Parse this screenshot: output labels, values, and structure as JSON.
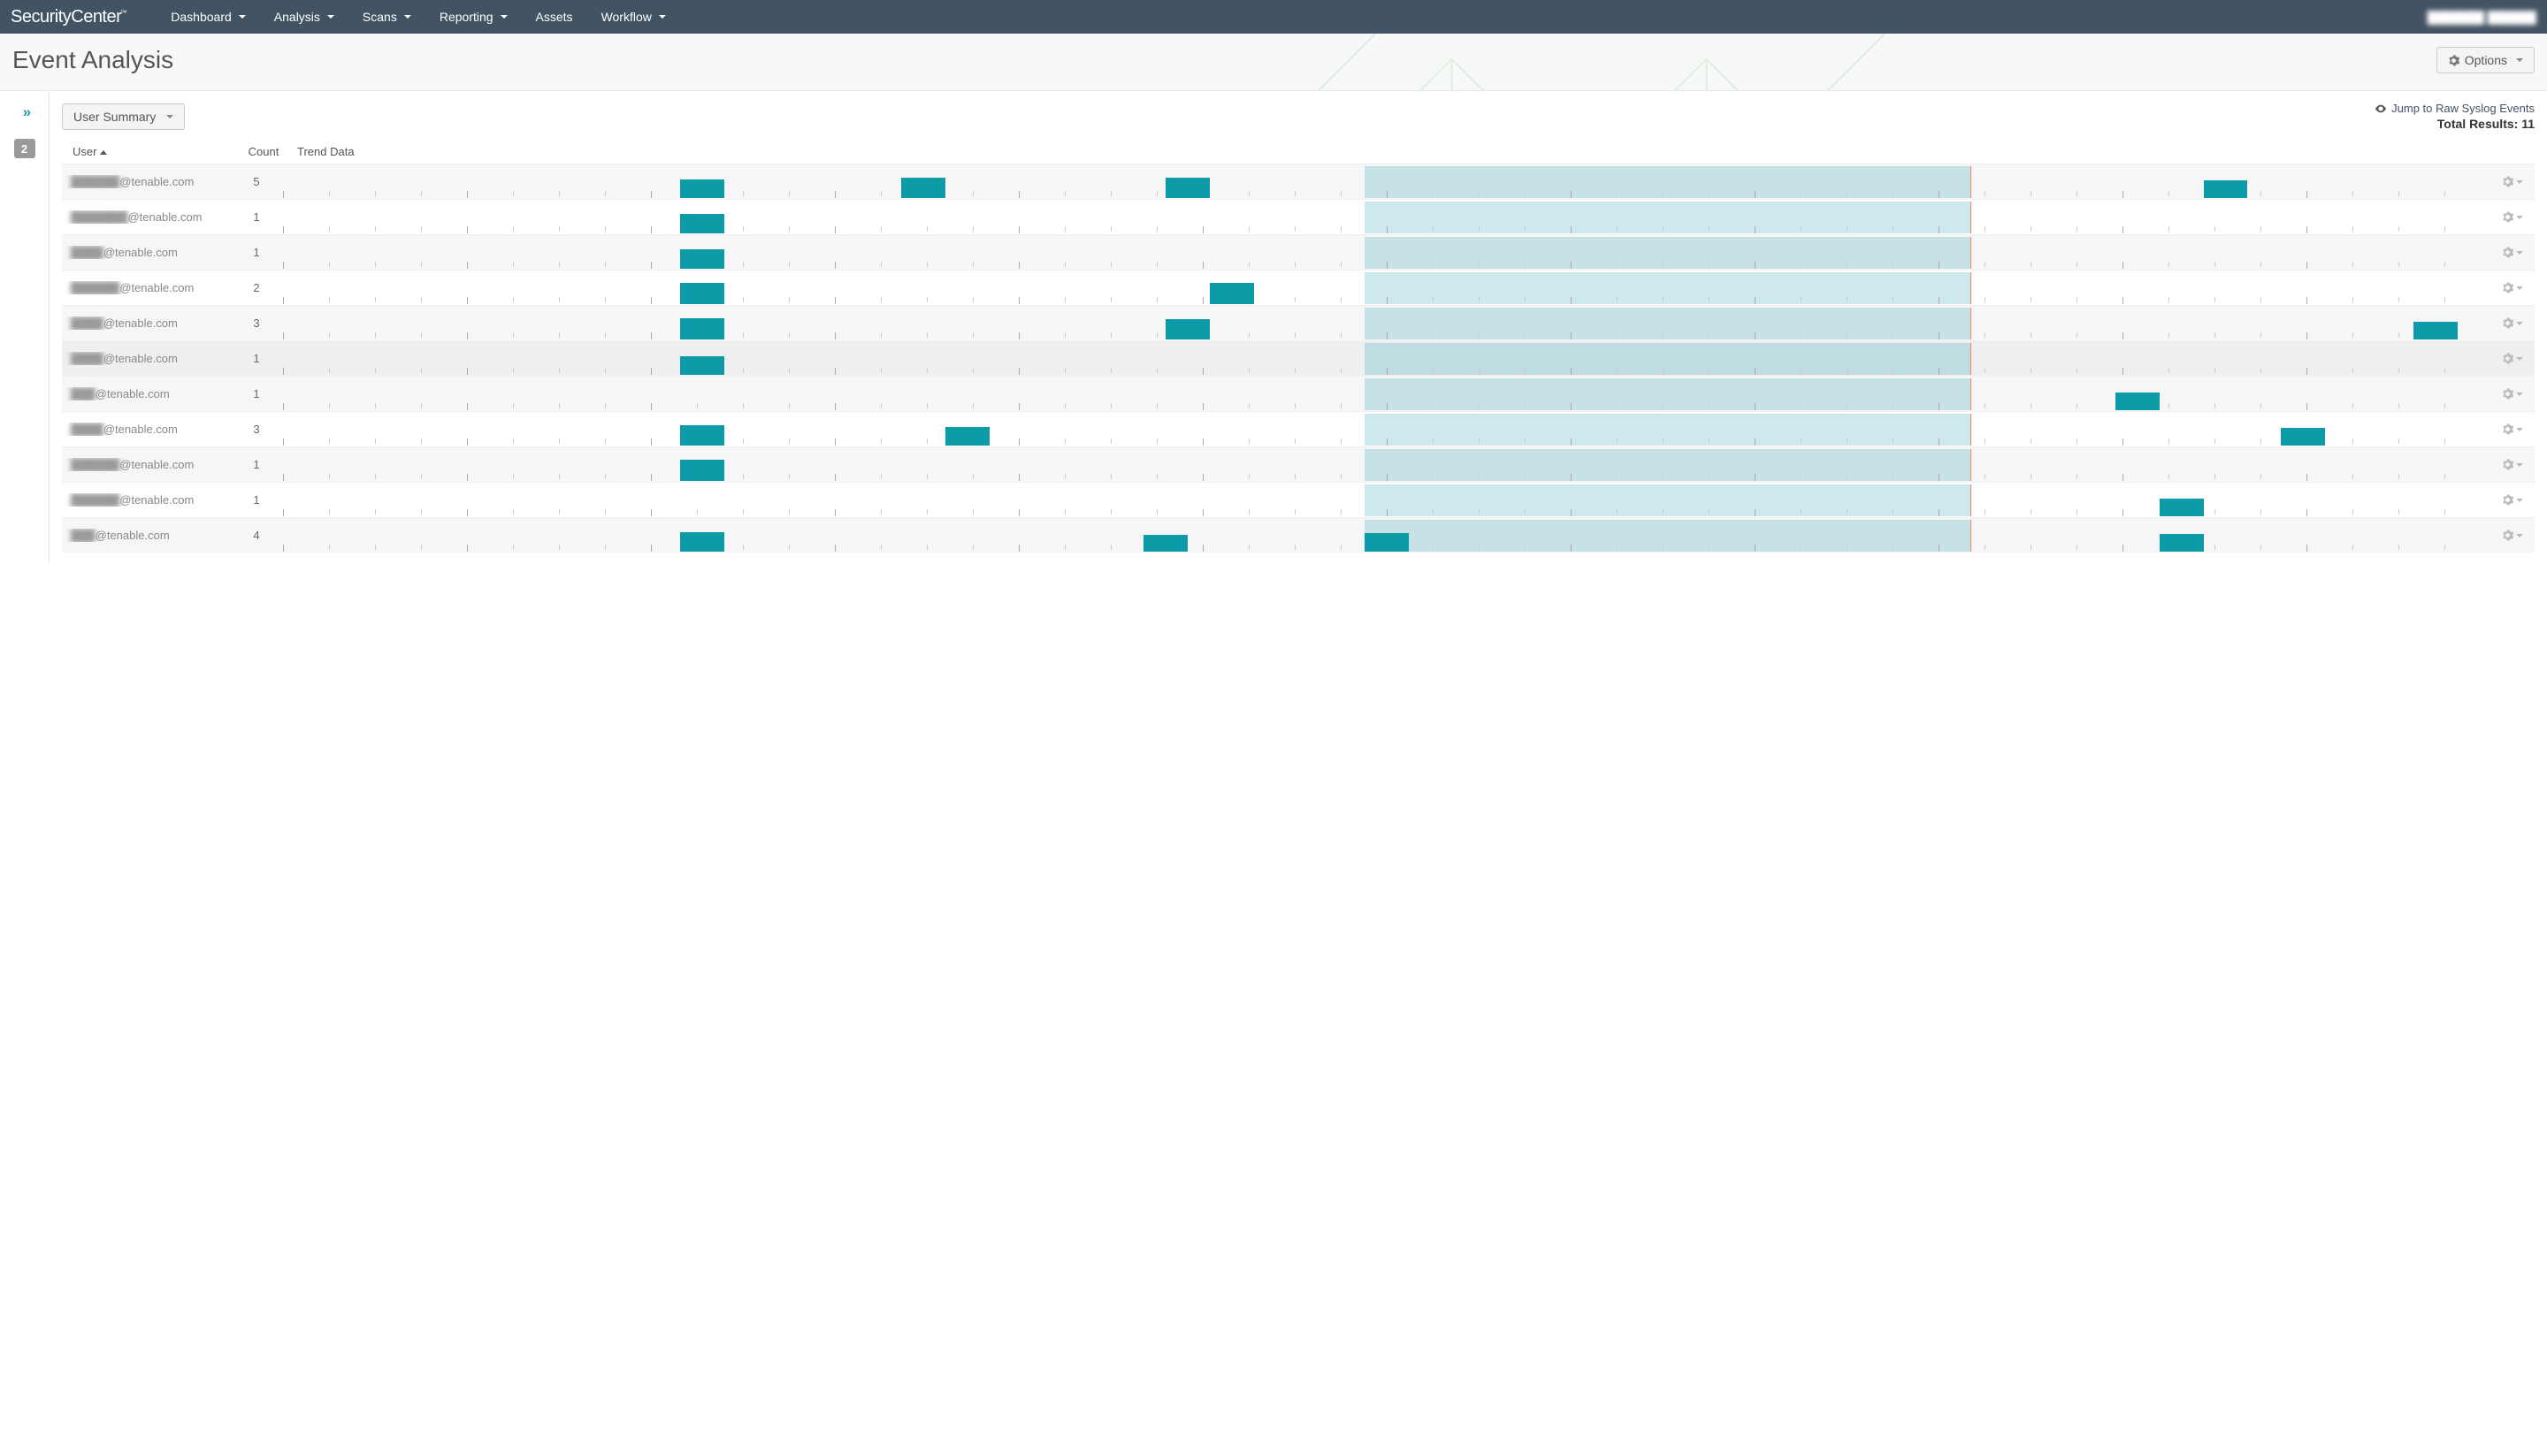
{
  "brand": "SecurityCenter",
  "nav": {
    "items": [
      {
        "label": "Dashboard",
        "dropdown": true
      },
      {
        "label": "Analysis",
        "dropdown": true
      },
      {
        "label": "Scans",
        "dropdown": true
      },
      {
        "label": "Reporting",
        "dropdown": true
      },
      {
        "label": "Assets",
        "dropdown": false
      },
      {
        "label": "Workflow",
        "dropdown": true
      }
    ],
    "user_display": "███████ ██████"
  },
  "page": {
    "title": "Event Analysis",
    "options_label": "Options"
  },
  "sidebar": {
    "filter_count": "2"
  },
  "toolbar": {
    "view_label": "User Summary",
    "jump_link": "Jump to Raw Syslog Events",
    "total_label": "Total Results: 11"
  },
  "columns": {
    "user": "User",
    "count": "Count",
    "trend": "Trend Data"
  },
  "colors": {
    "bar": "#0d9ba8",
    "band": "rgba(28,155,168,0.22)",
    "band_border": "#f08a5d"
  },
  "rows": [
    {
      "user_prefix": "██████",
      "user_suffix": "@tenable.com",
      "count": "5",
      "bars": [
        18,
        28,
        40
      ],
      "bar2_at": 87
    },
    {
      "user_prefix": "███████",
      "user_suffix": "@tenable.com",
      "count": "1",
      "bars": [
        18
      ]
    },
    {
      "user_prefix": "████",
      "user_suffix": "@tenable.com",
      "count": "1",
      "bars": [
        18
      ]
    },
    {
      "user_prefix": "██████",
      "user_suffix": "@tenable.com",
      "count": "2",
      "bars": [
        18,
        42
      ]
    },
    {
      "user_prefix": "████",
      "user_suffix": "@tenable.com",
      "count": "3",
      "bars": [
        18,
        40
      ],
      "bar2_at": 96.5
    },
    {
      "user_prefix": "████",
      "user_suffix": "@tenable.com",
      "count": "1",
      "bars": [
        18
      ],
      "hovered": true
    },
    {
      "user_prefix": "███",
      "user_suffix": "@tenable.com",
      "count": "1",
      "bars": [],
      "bar2_at": 83
    },
    {
      "user_prefix": "████",
      "user_suffix": "@tenable.com",
      "count": "3",
      "bars": [
        18,
        30
      ],
      "bar2_at": 90.5
    },
    {
      "user_prefix": "██████",
      "user_suffix": "@tenable.com",
      "count": "1",
      "bars": [
        18
      ]
    },
    {
      "user_prefix": "██████",
      "user_suffix": "@tenable.com",
      "count": "1",
      "bars": [],
      "bar2_at": 85
    },
    {
      "user_prefix": "███",
      "user_suffix": "@tenable.com",
      "count": "4",
      "bars": [
        18,
        39,
        49
      ],
      "bar2_at": 85
    }
  ],
  "chart_data": {
    "type": "bar",
    "note": "Per-row sparkline event timelines. X = relative time 0-100%. Highlighted band ≈ 49%–76.5%. Bars mark event occurrences.",
    "highlight_range_pct": [
      49,
      76.5
    ],
    "series": [
      {
        "name": "row1",
        "x_pct": [
          18,
          28,
          40,
          87
        ]
      },
      {
        "name": "row2",
        "x_pct": [
          18
        ]
      },
      {
        "name": "row3",
        "x_pct": [
          18
        ]
      },
      {
        "name": "row4",
        "x_pct": [
          18,
          42
        ]
      },
      {
        "name": "row5",
        "x_pct": [
          18,
          40,
          96.5
        ]
      },
      {
        "name": "row6",
        "x_pct": [
          18
        ]
      },
      {
        "name": "row7",
        "x_pct": [
          83
        ]
      },
      {
        "name": "row8",
        "x_pct": [
          18,
          30,
          90.5
        ]
      },
      {
        "name": "row9",
        "x_pct": [
          18
        ]
      },
      {
        "name": "row10",
        "x_pct": [
          85
        ]
      },
      {
        "name": "row11",
        "x_pct": [
          18,
          39,
          49,
          85
        ]
      }
    ]
  }
}
